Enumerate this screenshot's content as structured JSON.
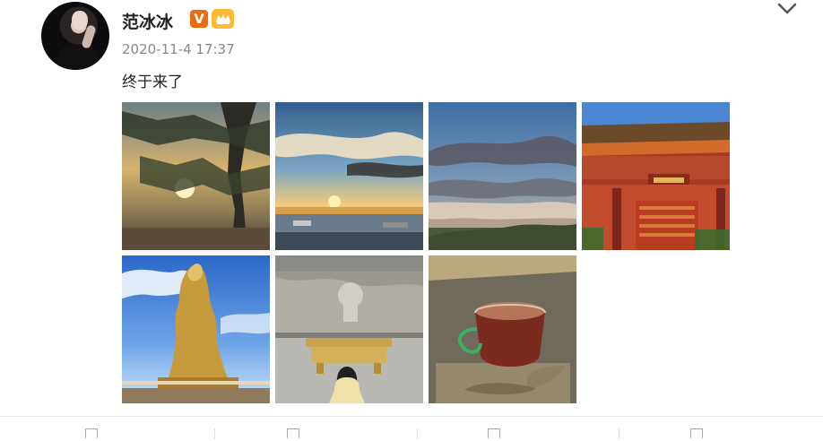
{
  "post": {
    "username": "范冰冰",
    "verified_badge": "V",
    "member_badge": "ᵥ",
    "timestamp": "2020-11-4 17:37",
    "text": "终于来了"
  },
  "images": [
    {
      "name": "sunset-tree-photo"
    },
    {
      "name": "sunset-sea-photo"
    },
    {
      "name": "cloudy-sky-photo"
    },
    {
      "name": "temple-eaves-photo"
    },
    {
      "name": "golden-statue-photo"
    },
    {
      "name": "stone-relief-photo"
    },
    {
      "name": "tea-cup-photo"
    }
  ],
  "actions": [
    {
      "icon": "share-icon",
      "label": ""
    },
    {
      "icon": "comment-icon",
      "label": ""
    },
    {
      "icon": "repost-icon",
      "label": ""
    },
    {
      "icon": "like-icon",
      "label": ""
    }
  ]
}
